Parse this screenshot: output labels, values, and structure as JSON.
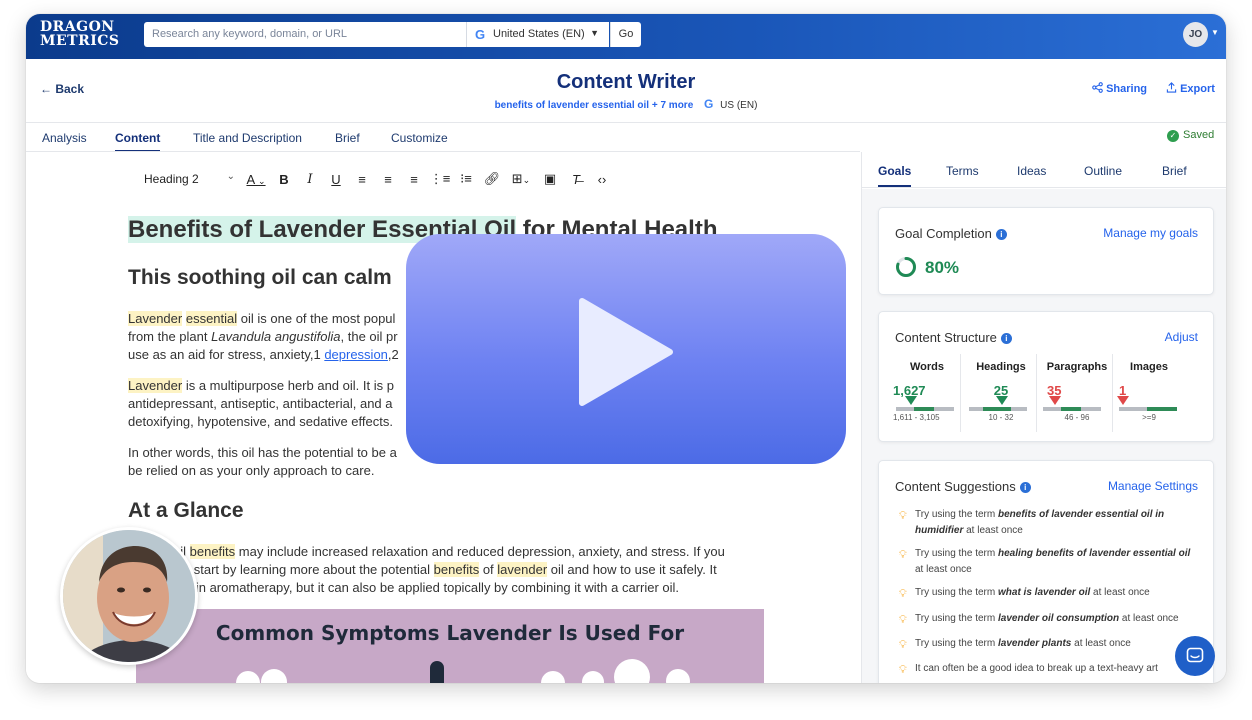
{
  "topbar": {
    "logo_line1": "DRAGON",
    "logo_line2": "METRICS",
    "search_placeholder": "Research any keyword, domain, or URL",
    "country": "United States (EN)",
    "go_label": "Go",
    "user_initials": "JO"
  },
  "header": {
    "back_label": "Back",
    "title": "Content Writer",
    "keyword": "benefits of lavender essential oil + 7 more",
    "locale": "US (EN)",
    "sharing_label": "Sharing",
    "export_label": "Export"
  },
  "tabs": [
    {
      "label": "Analysis",
      "active": false
    },
    {
      "label": "Content",
      "active": true
    },
    {
      "label": "Title and Description",
      "active": false
    },
    {
      "label": "Brief",
      "active": false
    },
    {
      "label": "Customize",
      "active": false
    }
  ],
  "saved_label": "Saved",
  "editor": {
    "block_format": "Heading 2",
    "toolbar_icons": [
      "text-color-icon",
      "bold-icon",
      "italic-icon",
      "underline-icon",
      "align-left-icon",
      "align-center-icon",
      "align-right-icon",
      "numbered-list-icon",
      "bullet-list-icon",
      "link-icon",
      "table-icon",
      "image-icon",
      "clear-format-icon",
      "code-icon"
    ],
    "h1_highlight": "Benefits of Lavender Essential Oil",
    "h1_rest": " for Mental Health",
    "h2_intro": "This soothing oil can calm",
    "p1_hl1": "Lavender",
    "p1_hl2": "essential",
    "p1_l1": " oil is one of the most popul",
    "p1_l2": "from the plant ",
    "p1_l2_italic": "Lavandula angustifolia",
    "p1_l2_end": ", the oil pr",
    "p1_l3": "use as an aid for stress, anxiety,1 ",
    "p1_link": "depression",
    "p1_l3_end": ",2",
    "p2_hl": "Lavender",
    "p2_l1": " is a multipurpose herb and oil. It is p",
    "p2_l2": "antidepressant, antiseptic, antibacterial, and a",
    "p2_l3": "detoxifying, hypotensive, and sedative effects.",
    "p3_l1": "In other words, this oil has the potential to be a",
    "p3_l2": "be relied on as your only approach to care.",
    "h2_glance": "At a Glance",
    "p4_l1a": "oil ",
    "p4_l1_hl": "benefits",
    "p4_l1b": " may include increased relaxation and reduced depression, anxiety, and stress. If you",
    "p4_l2a": "it, start by learning more about the potential ",
    "p4_l2_hl1": "benefits",
    "p4_l2b": " of ",
    "p4_l2_hl2": "lavender",
    "p4_l2c": " oil and how to use it safely. It",
    "p4_l3": "d in aromatherapy, but it can also be applied topically by combining it with a carrier oil.",
    "banner_title": "Common Symptoms Lavender Is Used For"
  },
  "right_tabs": [
    {
      "label": "Goals",
      "active": true
    },
    {
      "label": "Terms",
      "active": false
    },
    {
      "label": "Ideas",
      "active": false
    },
    {
      "label": "Outline",
      "active": false
    },
    {
      "label": "Brief",
      "active": false
    }
  ],
  "goal_card": {
    "title": "Goal Completion",
    "link": "Manage my goals",
    "percent": "80%",
    "completion_fraction": 0.8
  },
  "structure_card": {
    "title": "Content Structure",
    "link": "Adjust",
    "metrics": [
      {
        "label": "Words",
        "value": "1,627",
        "range": "1,611 - 3,105",
        "status": "ok"
      },
      {
        "label": "Headings",
        "value": "25",
        "range": "10 - 32",
        "status": "ok"
      },
      {
        "label": "Paragraphs",
        "value": "35",
        "range": "46 - 96",
        "status": "low"
      },
      {
        "label": "Images",
        "value": "1",
        "range": ">=9",
        "status": "low"
      }
    ],
    "colors": {
      "ok": "#1f8a55",
      "low": "#e04848"
    }
  },
  "suggestions_card": {
    "title": "Content Suggestions",
    "link": "Manage Settings",
    "items": [
      {
        "pre": "Try using the term ",
        "term": "benefits of lavender essential oil in humidifier",
        "post": " at least once"
      },
      {
        "pre": "Try using the term ",
        "term": "healing benefits of lavender essential oil",
        "post": " at least once"
      },
      {
        "pre": "Try using the term ",
        "term": "what is lavender oil",
        "post": " at least once"
      },
      {
        "pre": "Try using the term ",
        "term": "lavender oil consumption",
        "post": " at least once"
      },
      {
        "pre": "Try using the term ",
        "term": "lavender plants",
        "post": " at least once"
      },
      {
        "pre": "It can often be a good idea to break up a text-heavy art",
        "term": "",
        "post": ""
      }
    ]
  },
  "video_overlay": {
    "icon": "play-icon"
  },
  "chat": {
    "icon": "chat-icon"
  }
}
